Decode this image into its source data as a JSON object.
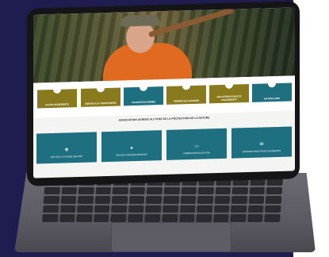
{
  "nav": {
    "items": [
      {
        "label": "ACCES ADHERENTS",
        "icon": "leaf-icon",
        "color": "#8a7a1e"
      },
      {
        "label": "BIENVE AUX TERRITOIRES",
        "icon": "pin-icon",
        "color": "#8a7a1e"
      },
      {
        "label": "VALIDATION PERMIS",
        "icon": "refresh-icon",
        "color": "#1e6f80"
      },
      {
        "label": "PERMIS DE CHASSER",
        "icon": "document-icon",
        "color": "#8a7a1e"
      },
      {
        "label": "BULLETINS PUBLICS DOCUMENTS",
        "icon": "house-icon",
        "color": "#8a7a1e"
      },
      {
        "label": "NATURA 2000",
        "icon": "bird-icon",
        "color": "#1e6f80"
      }
    ]
  },
  "section": {
    "title": "ASSOCIATION AGREEE AU TITRE DE LA PROTECTION DE LA NATURE"
  },
  "cards": [
    {
      "label": "BATTUE A LA PASSE SECURE",
      "icon": "paw-icon"
    },
    {
      "label": "PROTECTION DES ESPECES",
      "icon": "drop-icon"
    },
    {
      "label": "FORMATION EDUCATION",
      "icon": "book-icon"
    },
    {
      "label": "INFORMATIONS POUR CHASSEURS",
      "icon": "chat-icon"
    }
  ]
}
